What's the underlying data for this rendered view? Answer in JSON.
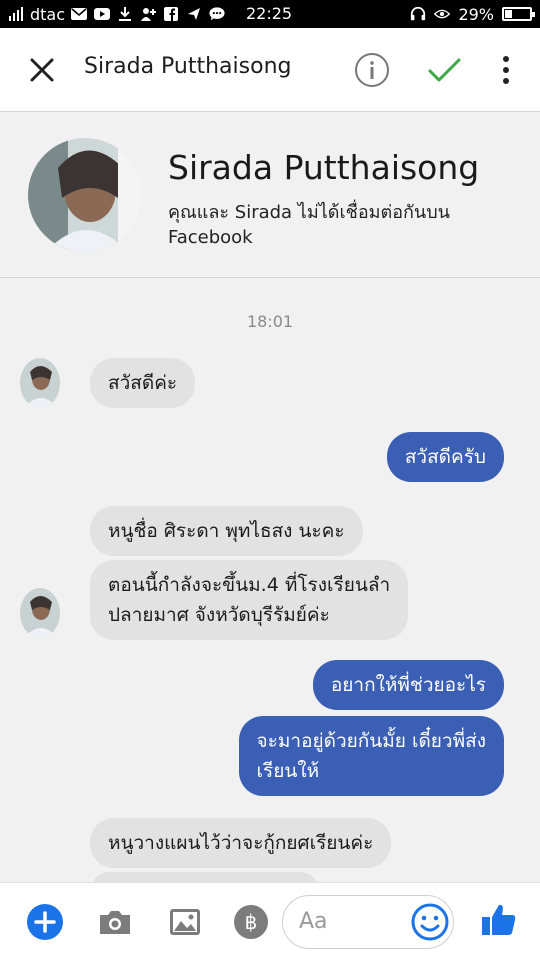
{
  "status_bar": {
    "carrier": "dtac",
    "time": "22:25",
    "battery_pct": "29%",
    "battery_level": 0.29
  },
  "app_bar": {
    "title": "Sirada Putthaisong",
    "accent_check_color": "#3aa843"
  },
  "profile": {
    "name": "Sirada Putthaisong",
    "subtitle": "คุณและ Sirada ไม่ได้เชื่อมต่อกันบน Facebook"
  },
  "chat": {
    "timestamp": "18:01",
    "messages": [
      {
        "side": "in",
        "text": "สวัสดีค่ะ"
      },
      {
        "side": "out",
        "text": "สวัสดีครับ"
      },
      {
        "side": "in",
        "text": "หนูชื่อ ศิระดา พุทไธสง นะคะ"
      },
      {
        "side": "in",
        "text": "ตอนนี้กำลังจะขึ้นม.4 ที่โรงเรียนลำ\nปลายมาศ จังหวัดบุรีรัมย์ค่ะ"
      },
      {
        "side": "out",
        "text": "อยากให้พี่ช่วยอะไร"
      },
      {
        "side": "out",
        "text": "จะมาอยู่ด้วยกันมั้ย เดี๋ยวพี่ส่ง\nเรียนให้"
      },
      {
        "side": "in",
        "text": "หนูวางแผนไว้ว่าจะกู้กยศเรียนค่ะ"
      }
    ],
    "bubble_out_color": "#3a5fb5",
    "bubble_in_color": "#e2e2e2"
  },
  "composer": {
    "placeholder": "Aa",
    "accent_color": "#1a73e8"
  }
}
